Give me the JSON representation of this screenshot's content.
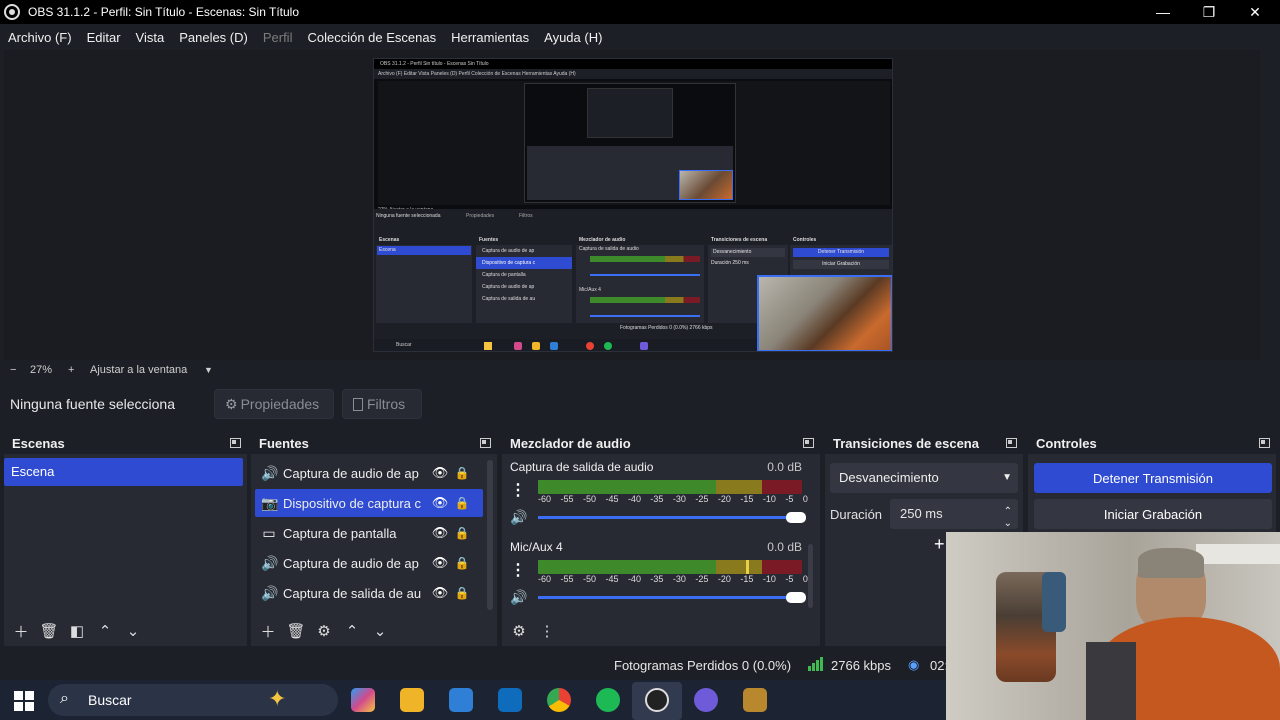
{
  "window": {
    "title": "OBS 31.1.2 - Perfil: Sin Título - Escenas: Sin Título",
    "minimize": "—",
    "maximize": "❐",
    "close": "✕"
  },
  "menu": [
    "Archivo (F)",
    "Editar",
    "Vista",
    "Paneles (D)",
    "Perfil",
    "Colección de Escenas",
    "Herramientas",
    "Ayuda (H)"
  ],
  "zoom": {
    "minus": "−",
    "value": "27%",
    "plus": "+",
    "fit": "Ajustar a la ventana",
    "caret": "▼"
  },
  "props": {
    "no_source": "Ninguna fuente selecciona",
    "properties": "Propiedades",
    "filters": "Filtros"
  },
  "scenes": {
    "title": "Escenas",
    "items": [
      "Escena"
    ]
  },
  "sources": {
    "title": "Fuentes",
    "items": [
      {
        "icon": "speaker-icon",
        "glyph": "🔊",
        "label": "Captura de audio de ap"
      },
      {
        "icon": "camera-icon",
        "glyph": "📷",
        "label": "Dispositivo de captura c"
      },
      {
        "icon": "monitor-icon",
        "glyph": "▭",
        "label": "Captura de pantalla"
      },
      {
        "icon": "speaker-icon",
        "glyph": "🔊",
        "label": "Captura de audio de ap"
      },
      {
        "icon": "speaker-icon",
        "glyph": "🔊",
        "label": "Captura de salida de au"
      }
    ]
  },
  "mixer": {
    "title": "Mezclador de audio",
    "ticks": [
      "-60",
      "-55",
      "-50",
      "-45",
      "-40",
      "-35",
      "-30",
      "-25",
      "-20",
      "-15",
      "-10",
      "-5",
      "0"
    ],
    "channels": [
      {
        "name": "Captura de salida de audio",
        "db": "0.0 dB",
        "volume": 1.0
      },
      {
        "name": "Mic/Aux 4",
        "db": "0.0 dB",
        "volume": 1.0
      }
    ]
  },
  "transitions": {
    "title": "Transiciones de escena",
    "type": "Desvanecimiento",
    "duration_label": "Duración",
    "duration": "250 ms",
    "add": "+"
  },
  "controls": {
    "title": "Controles",
    "stop_stream": "Detener Transmisión",
    "start_record": "Iniciar Grabación"
  },
  "status": {
    "frames_dropped": "Fotogramas Perdidos 0 (0.0%)",
    "bitrate": "2766 kbps",
    "time": "02:"
  },
  "taskbar": {
    "search": "Buscar"
  },
  "colors": {
    "accent": "#2e4bd1",
    "panel": "#272a33",
    "bg": "#1d1f26"
  },
  "mini": {
    "title": "OBS 31.1.2 - Perfil Sin título - Escenas Sin Título",
    "menu": "Archivo (F)   Editar   Vista   Paneles (D)   Perfil   Colección de Escenas   Herramientas   Ayuda (H)",
    "zoom": "27%   Ajustar a la ventana",
    "no_source": "Ninguna fuente seleccionada",
    "props": "Propiedades",
    "filters": "Filtros",
    "scenes": "Escenas",
    "scene": "Escena",
    "sources": "Fuentes",
    "src": [
      "Captura de audio de ap",
      "Dispositivo de captura c",
      "Captura de pantalla",
      "Captura de audio de ap",
      "Captura de salida de au"
    ],
    "mixer": "Mezclador de audio",
    "ch1": "Captura de salida de audio",
    "ch2": "Mic/Aux 4",
    "db": "0.0 dB",
    "trans": "Transiciones de escena",
    "trans_type": "Desvanecimiento",
    "dur_label": "Duración",
    "dur": "250 ms",
    "ctl": "Controles",
    "stop": "Detener Transmisión",
    "rec": "Iniciar Grabación",
    "status": "Fotogramas Perdidos 0 (0.0%)   2766 kbps",
    "search": "Buscar"
  }
}
